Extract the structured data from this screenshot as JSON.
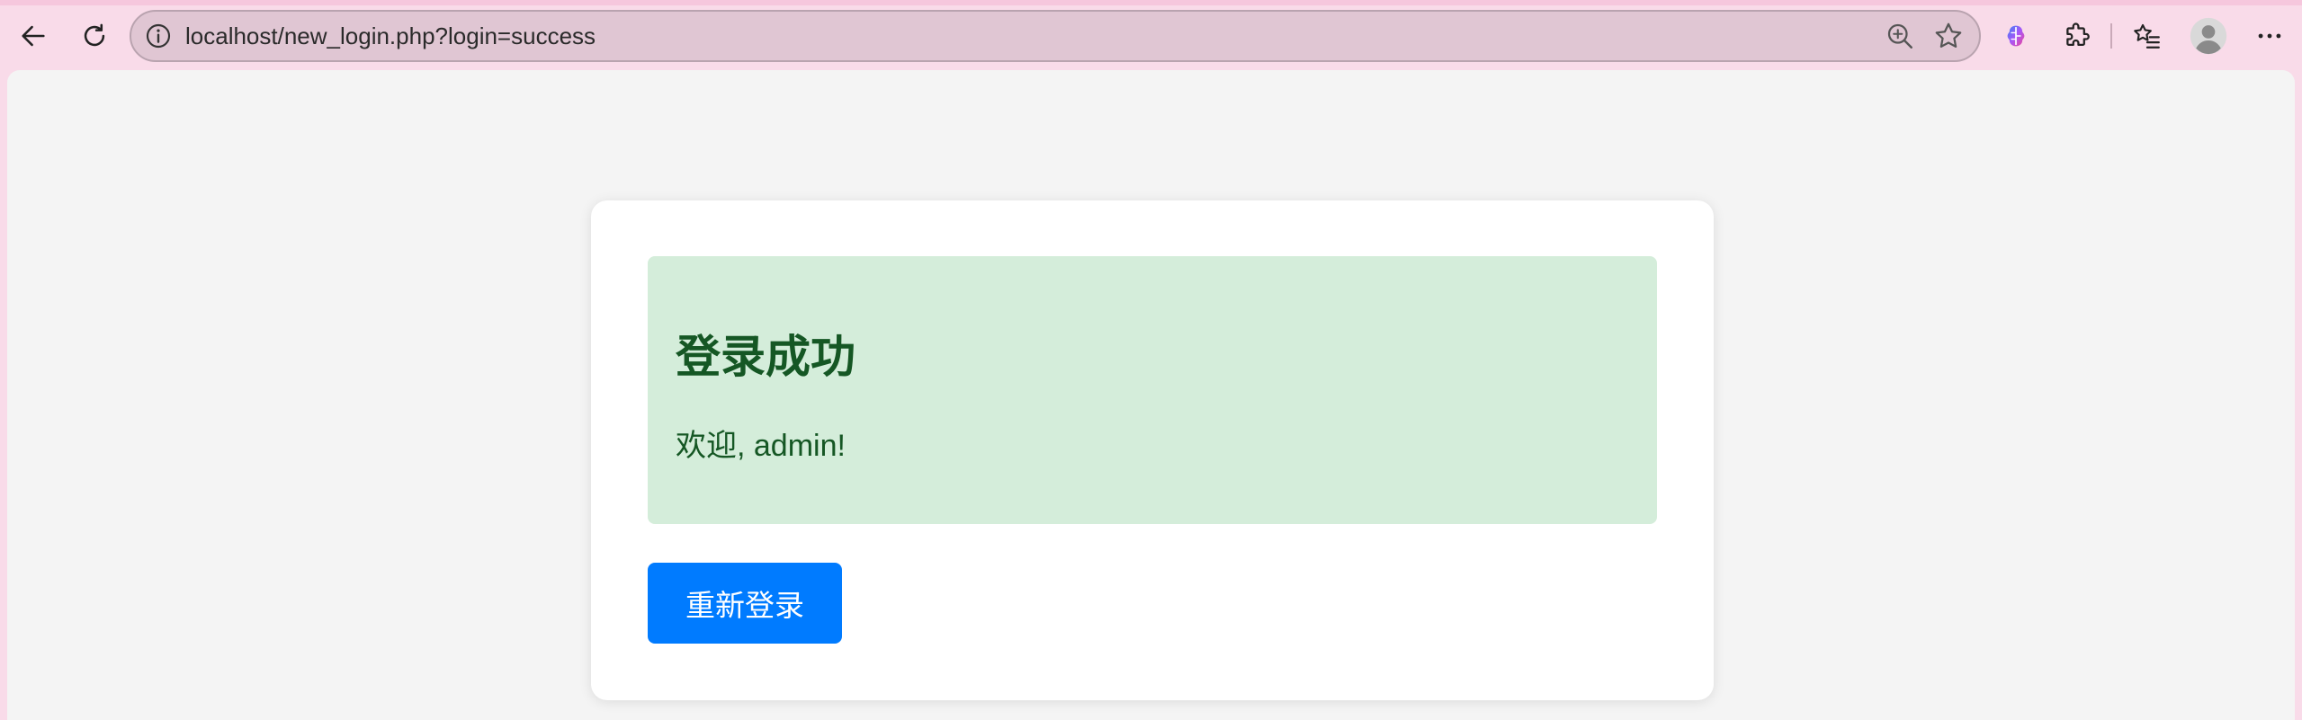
{
  "browser": {
    "url": "localhost/new_login.php?login=success",
    "icons": {
      "back": "back-arrow-icon",
      "reload": "reload-icon",
      "info": "info-icon",
      "zoom": "zoom-in-icon",
      "favorite": "star-icon",
      "copilot": "copilot-icon",
      "extensions": "puzzle-icon",
      "favorites": "favorites-list-icon",
      "profile": "profile-avatar-icon",
      "menu": "more-menu-icon"
    }
  },
  "page": {
    "success_title": "登录成功",
    "welcome_message": "欢迎, admin!",
    "relogin_label": "重新登录"
  },
  "colors": {
    "success_bg": "#d4edda",
    "success_text": "#155724",
    "button_bg": "#007bff",
    "page_bg": "#f4f4f4",
    "chrome_bg": "#f9dbe9"
  }
}
